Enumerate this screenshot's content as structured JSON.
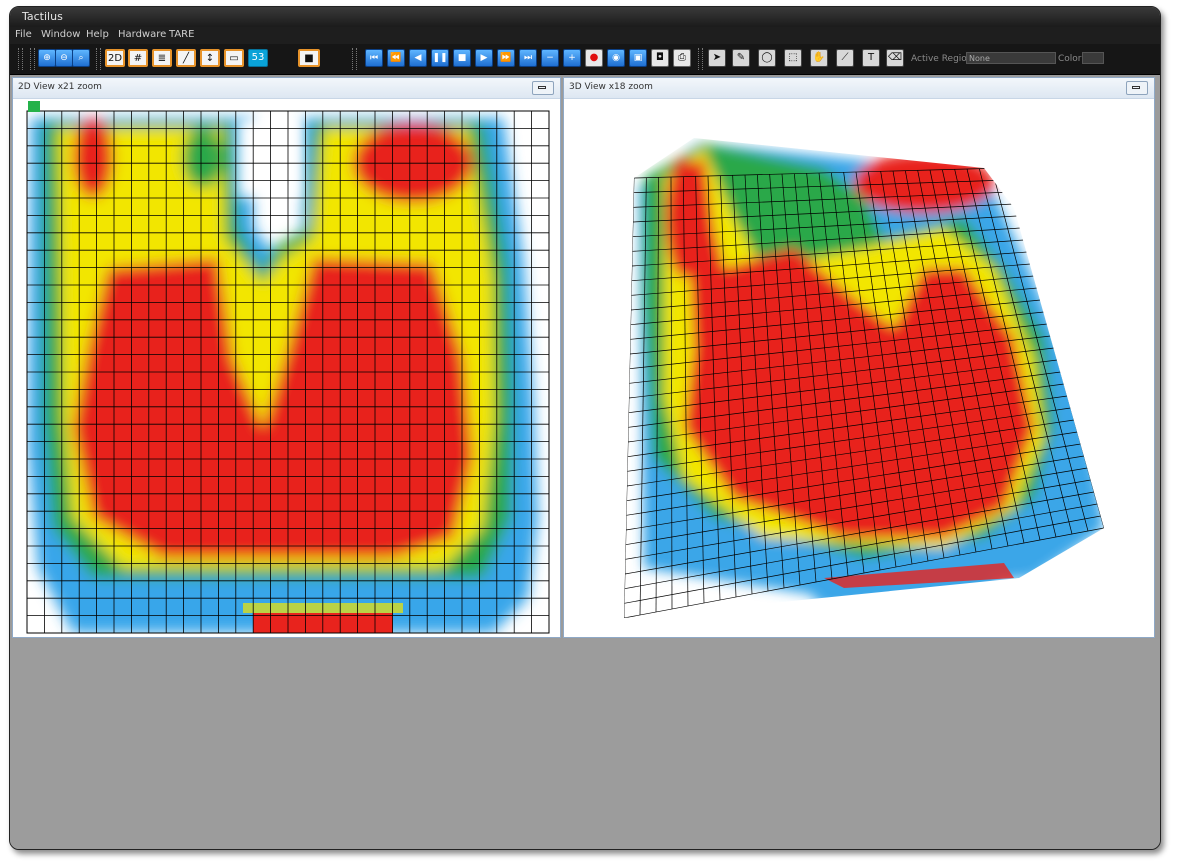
{
  "window": {
    "title": "Tactilus"
  },
  "menu": [
    "File",
    "Window",
    "Help",
    "Hardware",
    "TARE"
  ],
  "toolbar": {
    "view_2d_label": "2D",
    "frame_counter": "53",
    "active_region_label": "Active Region:",
    "active_region_value": "None",
    "color_label": "Color:",
    "zoom_buttons": [
      "zoom-in-icon",
      "zoom-out-icon",
      "zoom-fit-icon"
    ],
    "view_buttons": [
      "2d-view-icon",
      "grid-icon",
      "scale-icon",
      "curve-icon",
      "levels-icon",
      "legend-icon"
    ],
    "playback_buttons": [
      "first-frame-icon",
      "rewind-icon",
      "step-back-icon",
      "pause-icon",
      "stop-icon",
      "play-icon",
      "fast-forward-icon",
      "last-frame-icon",
      "minus-icon",
      "plus-icon",
      "record-icon",
      "eye-icon",
      "save-icon",
      "camera-icon",
      "print-icon"
    ],
    "tool_buttons": [
      "pointer-icon",
      "pen-icon",
      "ellipse-select-icon",
      "rect-select-icon",
      "hand-icon",
      "line-icon",
      "text-icon",
      "eraser-icon"
    ]
  },
  "panels": {
    "view2d": {
      "title": "2D View  x21 zoom"
    },
    "view3d": {
      "title": "3D View  x18 zoom"
    }
  },
  "colors": {
    "heat_low": "#2b8fe0",
    "heat_mid": "#f2e600",
    "heat_high": "#e8231d",
    "toolbar_bg": "#161616",
    "panel_border": "#8fa9c7"
  }
}
